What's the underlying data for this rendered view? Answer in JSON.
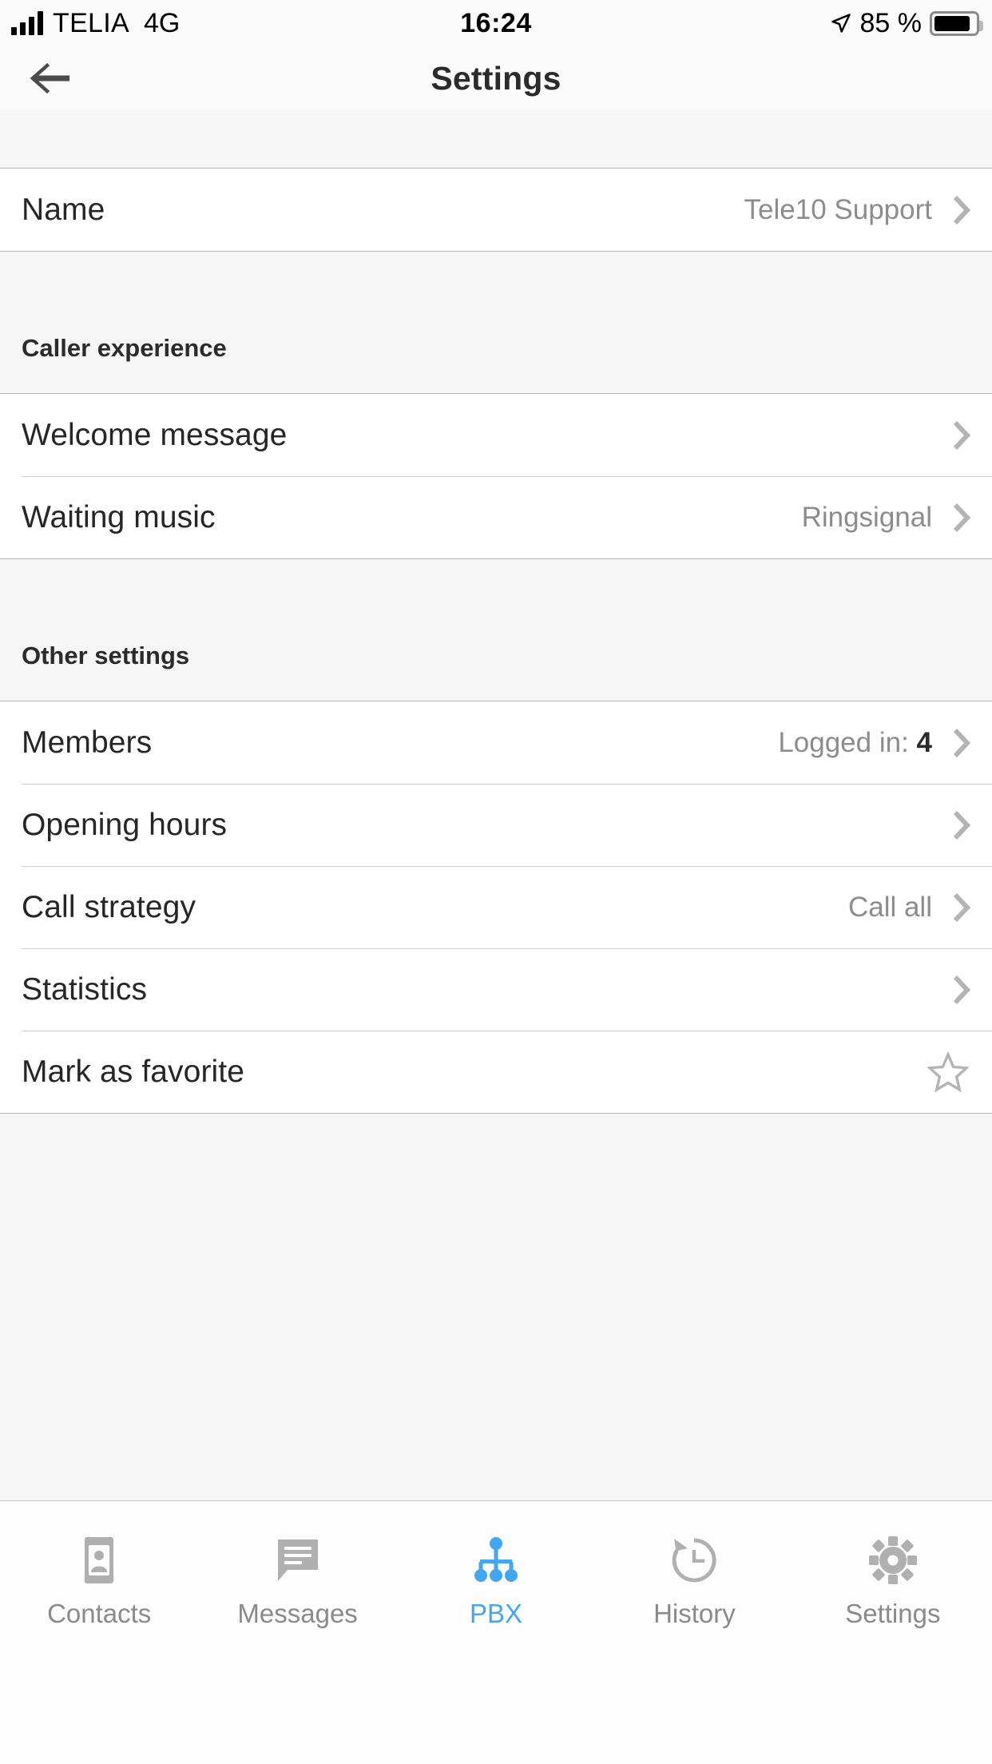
{
  "status_bar": {
    "carrier": "TELIA",
    "network": "4G",
    "time": "16:24",
    "battery_percent": "85 %",
    "signal_icon": "signal-bars-icon",
    "location_icon": "location-arrow-icon",
    "battery_icon": "battery-full-icon"
  },
  "nav": {
    "title": "Settings",
    "back_icon": "arrow-left-icon"
  },
  "sections": [
    {
      "type": "gap",
      "header": "",
      "rows": [
        {
          "label": "Name",
          "value": "Tele10 Support",
          "accessory": "chevron-right-icon"
        }
      ]
    },
    {
      "type": "titled",
      "header": "Caller experience",
      "rows": [
        {
          "label": "Welcome message",
          "value": "",
          "accessory": "chevron-right-icon"
        },
        {
          "label": "Waiting music",
          "value": "Ringsignal",
          "accessory": "chevron-right-icon"
        }
      ]
    },
    {
      "type": "titled",
      "header": "Other settings",
      "rows": [
        {
          "label": "Members",
          "value": "Logged in:",
          "value_strong": "4",
          "accessory": "chevron-right-icon"
        },
        {
          "label": "Opening hours",
          "value": "",
          "accessory": "chevron-right-icon"
        },
        {
          "label": "Call strategy",
          "value": "Call all",
          "accessory": "chevron-right-icon"
        },
        {
          "label": "Statistics",
          "value": "",
          "accessory": "chevron-right-icon"
        },
        {
          "label": "Mark as favorite",
          "value": "",
          "accessory": "star-outline-icon"
        }
      ]
    }
  ],
  "tabbar": {
    "active": "PBX",
    "active_color": "#43a6f5",
    "inactive_color": "#8a8a8a",
    "items": [
      {
        "label": "Contacts",
        "icon": "contact-card-icon"
      },
      {
        "label": "Messages",
        "icon": "message-bubble-icon"
      },
      {
        "label": "PBX",
        "icon": "pbx-hierarchy-icon"
      },
      {
        "label": "History",
        "icon": "clock-history-icon"
      },
      {
        "label": "Settings",
        "icon": "gear-icon"
      }
    ]
  }
}
